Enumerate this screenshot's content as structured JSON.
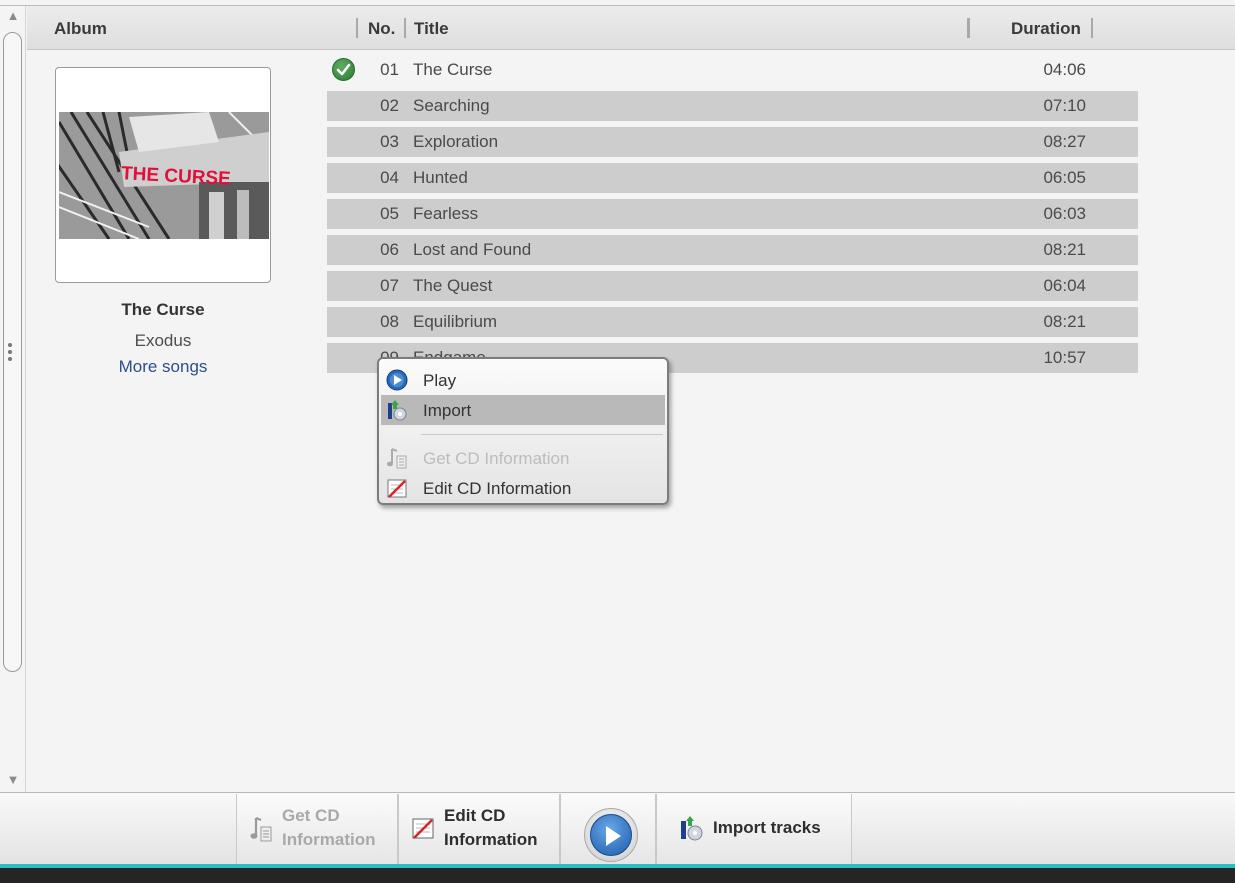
{
  "header": {
    "album_label": "Album",
    "no_label": "No.",
    "title_label": "Title",
    "duration_label": "Duration"
  },
  "album": {
    "cover_text": "THE CURSE",
    "title": "The Curse",
    "artist": "Exodus",
    "more_songs": "More songs"
  },
  "tracks": [
    {
      "no": "01",
      "title": "The Curse",
      "duration": "04:06",
      "imported": true
    },
    {
      "no": "02",
      "title": "Searching",
      "duration": "07:10"
    },
    {
      "no": "03",
      "title": "Exploration",
      "duration": "08:27"
    },
    {
      "no": "04",
      "title": "Hunted",
      "duration": "06:05"
    },
    {
      "no": "05",
      "title": "Fearless",
      "duration": "06:03"
    },
    {
      "no": "06",
      "title": "Lost and Found",
      "duration": "08:21"
    },
    {
      "no": "07",
      "title": "The Quest",
      "duration": "06:04"
    },
    {
      "no": "08",
      "title": "Equilibrium",
      "duration": "08:21"
    },
    {
      "no": "09",
      "title": "Endgame",
      "duration": "10:57"
    }
  ],
  "context_menu": {
    "play": "Play",
    "import": "Import",
    "get_cd_info": "Get CD Information",
    "edit_cd_info": "Edit CD Information"
  },
  "toolbar": {
    "get_cd_info_line1": "Get CD",
    "get_cd_info_line2": "Information",
    "edit_cd_info_line1": "Edit CD",
    "edit_cd_info_line2": "Information",
    "import_tracks": "Import tracks"
  },
  "colors": {
    "accent_teal": "#2dbdc4",
    "link_blue": "#2b4f8e",
    "row_shade": "#cdcdcd",
    "check_green": "#3d8f43"
  }
}
